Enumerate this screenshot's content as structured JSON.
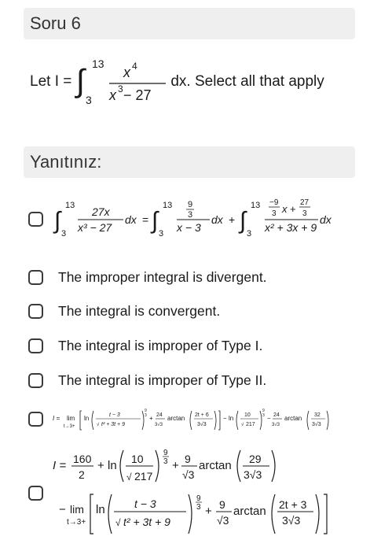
{
  "question": {
    "header": "Soru 6",
    "stem_prefix": "Let I =",
    "stem_suffix": "dx. Select all that apply",
    "integral": {
      "upper": "13",
      "lower": "3",
      "numerator": "x",
      "numerator_exp": "4",
      "denominator": "x",
      "denominator_exp": "3",
      "denominator_rest": " − 27"
    }
  },
  "answer": {
    "header": "Yanıtınız:",
    "options": [
      {
        "id": "a",
        "checked": false,
        "math": "∫_3^13 27x/(x^3 − 27) dx = ∫_3^13 (9/3)/(x − 3) dx + ∫_3^13 ((−9/3)x + 27/3)/(x^2 + 3x + 9) dx"
      },
      {
        "id": "b",
        "checked": false,
        "label": "The improper integral is divergent."
      },
      {
        "id": "c",
        "checked": false,
        "label": "The integral is convergent."
      },
      {
        "id": "d",
        "checked": false,
        "label": "The integral is improper of Type I."
      },
      {
        "id": "e",
        "checked": false,
        "label": "The integral is improper of Type II."
      },
      {
        "id": "f",
        "checked": false,
        "math": "I = lim_(t→3+) [ ln( (t−3)/√(t^2+3t+9) )^(9/3) + 24/(3√3) arctan( (2t+6)/(3√3) ) ] − ln( 10/√217 )^(9/3) − 24/(3√3) arctan( 32/(3√3) )"
      },
      {
        "id": "g",
        "checked": false,
        "math": "I = 160/2 + ln( 10/√217 )^(9/3) + 9/√3 arctan( 29/(3√3) ) − lim_(t→3+) [ ln( (t−3)/√(t^2+3t+9) )^(9/3) + 9/√3 arctan( (2t+3)/(3√3) ) ]"
      }
    ]
  },
  "glyphs": {
    "int": "∫",
    "eq": "=",
    "plus": "+",
    "minus": "−",
    "dx": "dx",
    "lim": "lim",
    "ln": "ln",
    "arctan": "arctan",
    "sqrt": "√",
    "t_to_3": "t→3+",
    "I_eq": "I =",
    "n13": "13",
    "n3": "3",
    "n9": "9",
    "n2": "2",
    "n24": "24",
    "n27": "27",
    "n10": "10",
    "n160": "160",
    "n29": "29",
    "n32": "32",
    "frac_27x": "27x",
    "x3m27": "x³ − 27",
    "xm3": "x − 3",
    "m9": "−9",
    "x_word": "x",
    "x2p3xp9": "x² + 3x + 9",
    "tm3": "t − 3",
    "t2p3tp9": "t² + 3t + 9",
    "sqrt217": "217",
    "two_t6": "2t + 6",
    "two_t3": "2t + 3",
    "three_sqrt3": "3√3",
    "three": "3",
    "sqrt3": "√3"
  }
}
